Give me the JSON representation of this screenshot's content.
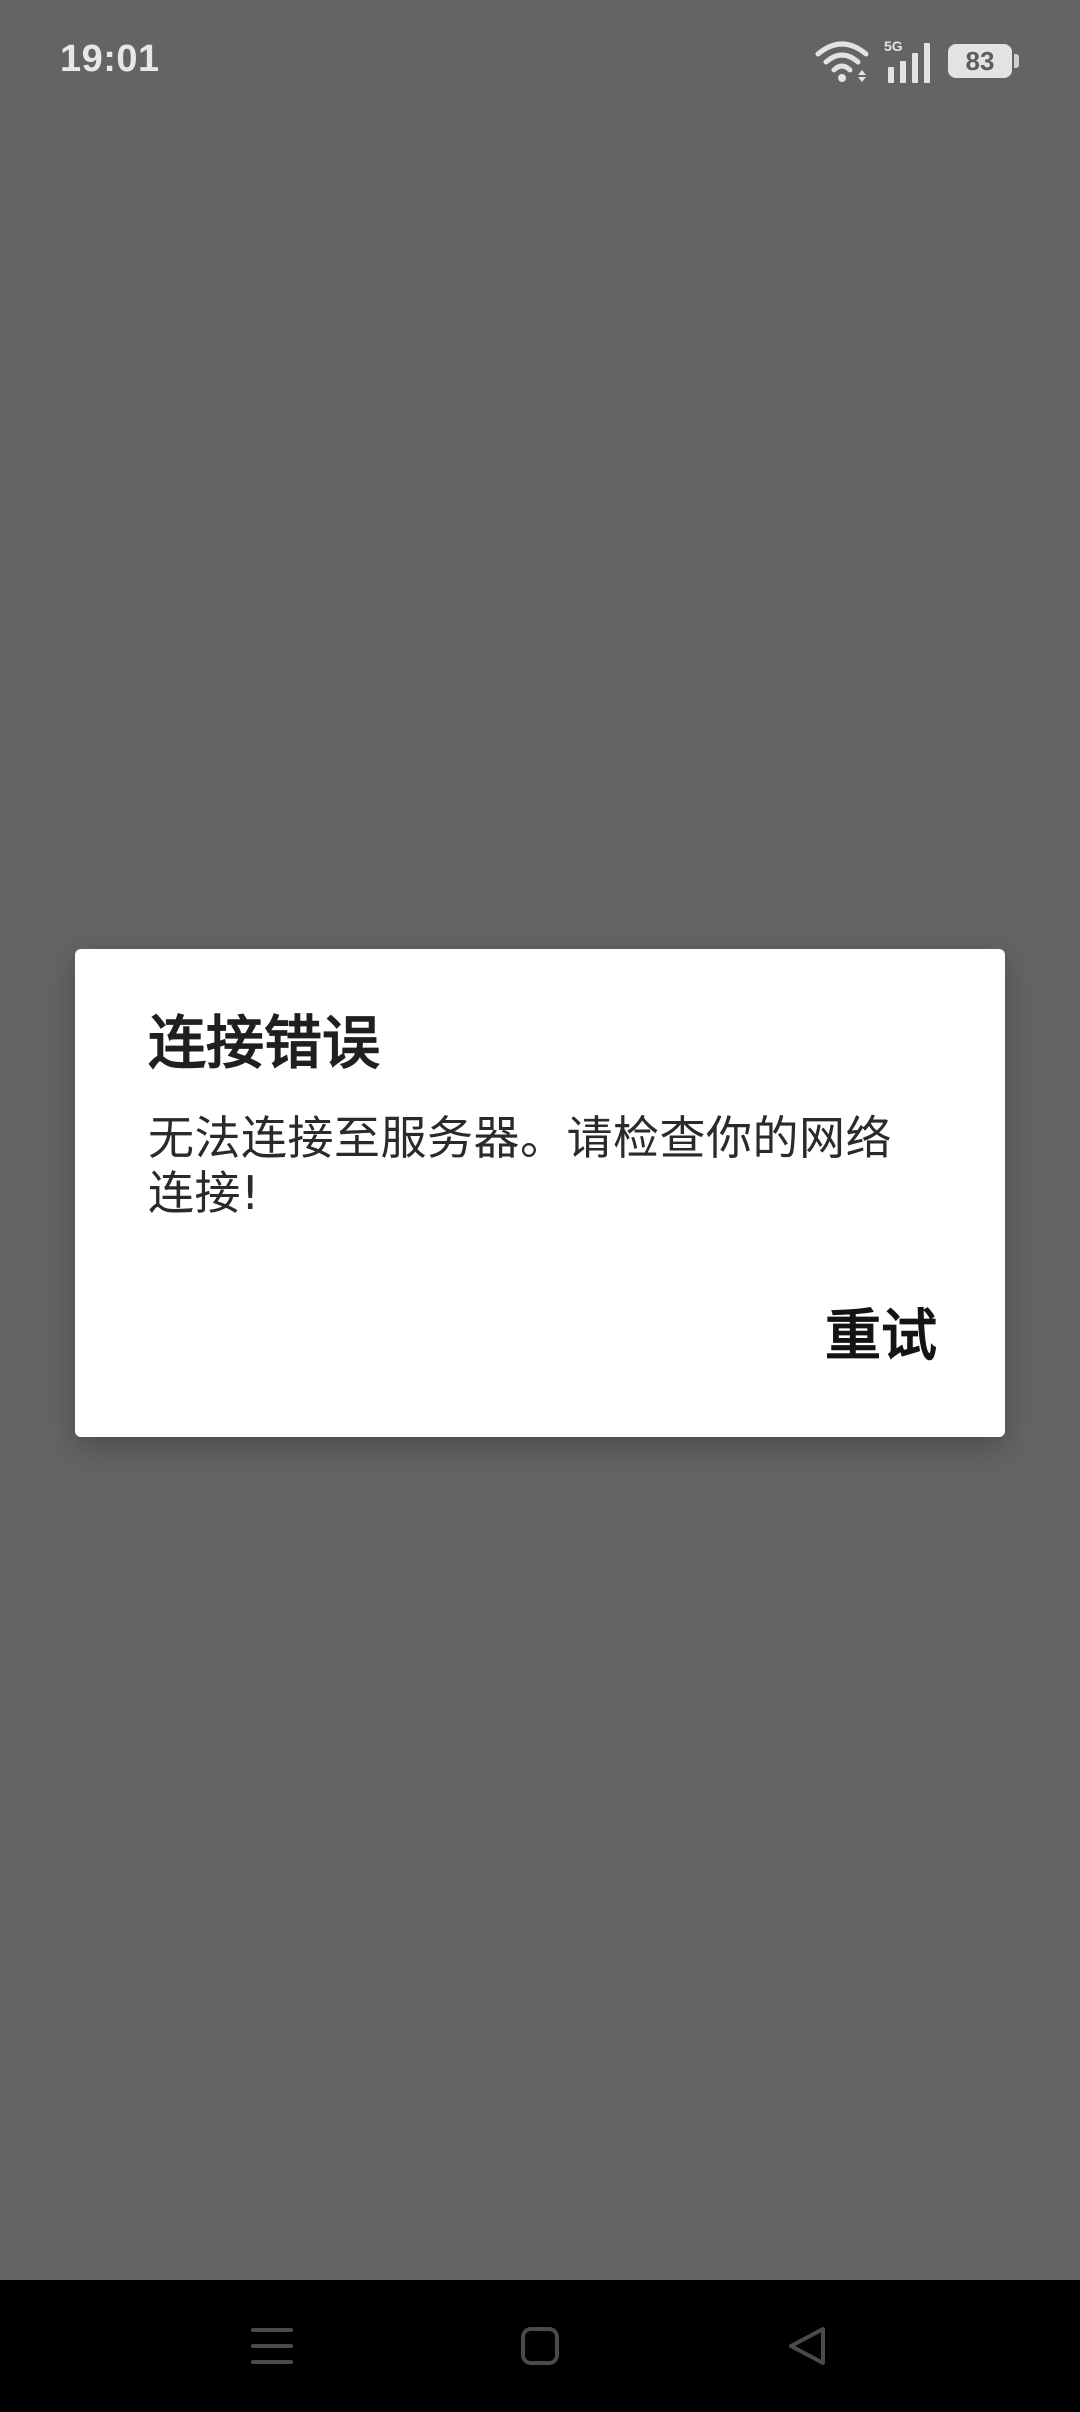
{
  "status_bar": {
    "time": "19:01",
    "network_type": "5G",
    "battery_level": "83",
    "icons": [
      "wifi-icon",
      "signal-icon",
      "battery-icon"
    ]
  },
  "dialog": {
    "title": "连接错误",
    "message": "无法连接至服务器。请检查你的网络连接!",
    "button_label": "重试"
  },
  "nav_bar": {
    "icons": [
      "menu-icon",
      "home-icon",
      "back-icon"
    ]
  },
  "colors": {
    "background_overlay": "#646464",
    "dialog_background": "#ffffff",
    "nav_bar": "#000000"
  }
}
